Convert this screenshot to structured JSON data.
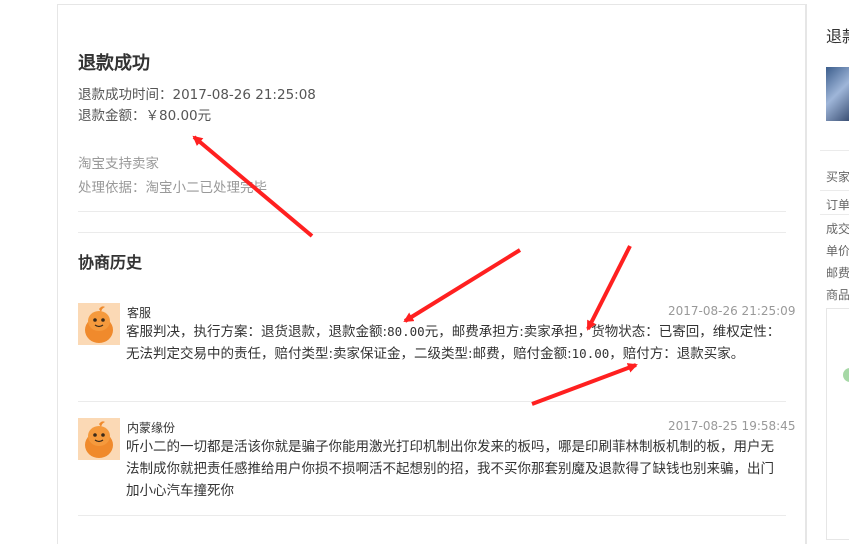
{
  "refund": {
    "title": "退款成功",
    "time_label": "退款成功时间：",
    "time_value": "2017-08-26 21:25:08",
    "amount_label": "退款金额：",
    "amount_value": "￥80.00元",
    "support_text": "淘宝支持卖家",
    "basis_text": "处理依据：淘宝小二已处理完毕"
  },
  "history": {
    "title": "协商历史",
    "messages": [
      {
        "name": "客服",
        "time": "2017-08-26 21:25:09",
        "p1": "客服判决，执行方案：退货退款，退款金额:",
        "amount": "80.00",
        "p2": "元，邮费承担方:卖家承担，货物状态：已寄回，维权定性：无法判定交易中的责任，赔付类型:卖家保证金，二级类型:邮费，赔付金额:",
        "comp": "10.00",
        "p3": "，赔付方：退款买家。"
      },
      {
        "name": "内蒙缘份",
        "time": "2017-08-25 19:58:45",
        "body": "听小二的一切都是活该你就是骗子你能用激光打印机制出你发来的板吗，哪是印刷菲林制板机制的板，用户无法制成你就把责任感推给用户你损不损啊活不起想别的招，我不买你那套别魔及退款得了缺钱也别来骗，出门加小心汽车撞死你"
      }
    ]
  },
  "sidebar": {
    "title": "退款",
    "labels": [
      "买家",
      "订单",
      "成交",
      "单价",
      "邮费",
      "商品"
    ]
  },
  "colors": {
    "arrow": "#ff2020",
    "avatar_bg": "#f6c79b",
    "text_primary": "#333333",
    "text_muted": "#999999"
  }
}
